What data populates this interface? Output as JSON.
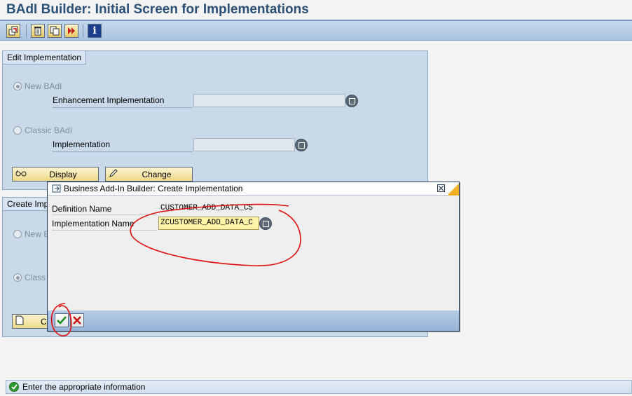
{
  "window": {
    "title": "BAdI Builder: Initial Screen for Implementations"
  },
  "toolbar": {
    "icons": [
      "other-object-icon",
      "delete-icon",
      "copy-icon",
      "rename-icon",
      "info-icon"
    ]
  },
  "edit_group": {
    "title": "Edit Implementation",
    "new_badi_label": "New BAdI",
    "enhancement_impl_label": "Enhancement Implementation",
    "enhancement_impl_value": "",
    "classic_badi_label": "Classic BAdI",
    "implementation_label": "Implementation",
    "implementation_value": "",
    "display_button": "Display",
    "change_button": "Change"
  },
  "create_group": {
    "title": "Create Impl",
    "new_badi_label": "New B",
    "classic_badi_label": "Class",
    "create_button": "C"
  },
  "dialog": {
    "title": "Business Add-In Builder: Create Implementation",
    "definition_name_label": "Definition Name",
    "definition_name_value": "CUSTOMER_ADD_DATA_CS",
    "implementation_name_label": "Implementation Name",
    "implementation_name_value": "ZCUSTOMER_ADD_DATA_C",
    "confirm_icon": "check-icon",
    "cancel_icon": "cancel-icon"
  },
  "status_bar": {
    "message": "Enter the appropriate information",
    "icon": "success-icon"
  },
  "colors": {
    "title_text": "#2b4f76",
    "toolbar_bg": "#a9c3e0",
    "group_bg": "#c9d9ea",
    "dialog_footer": "#97b3d6",
    "annotation_red": "#e01010",
    "input_highlight": "#fff4a8"
  }
}
